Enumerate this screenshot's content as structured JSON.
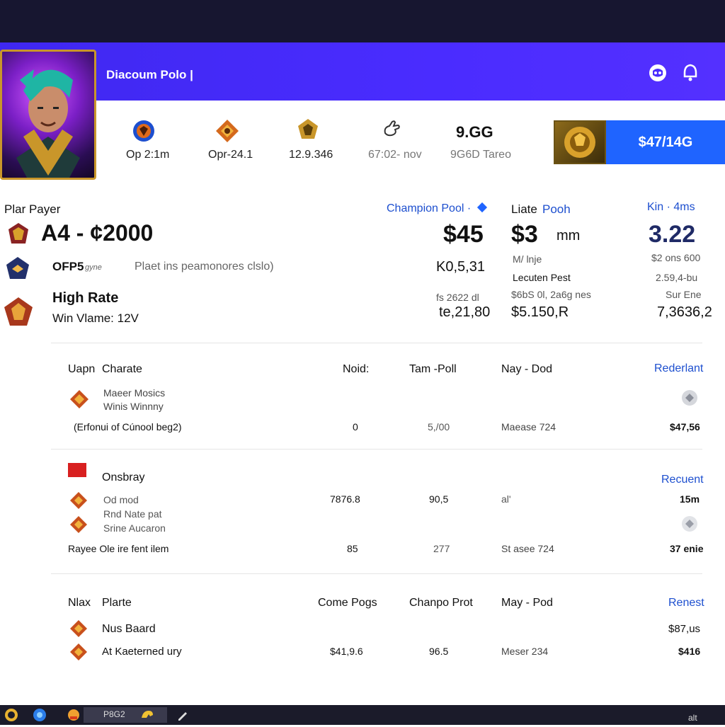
{
  "header": {
    "title": "Diacoum Polo |",
    "icons": [
      "discord-icon",
      "notification-bell-icon"
    ]
  },
  "stats": [
    {
      "icon": "emblem-blue-icon",
      "label": "Op 2:1m"
    },
    {
      "icon": "emblem-orange-icon",
      "label": "Opr-24.1"
    },
    {
      "icon": "emblem-gold-icon",
      "label": "12.9.346"
    },
    {
      "icon": "hand-icon",
      "label": "67:02- nov"
    },
    {
      "icon": "",
      "value": "9.GG",
      "label": "9G6D Tareo"
    }
  ],
  "price_button": "$47/14G",
  "player": {
    "section_label": "Plar Payer",
    "headline": "A4  -  ¢2000",
    "row1": {
      "label": "OFP5",
      "tag": "gyne",
      "desc": "Plaet ins peamonores clslo)"
    },
    "row2": {
      "title": "High Rate",
      "subtitle": "Win Vlame: 12V"
    }
  },
  "columns": {
    "champion_pool": {
      "label": "Champion Pool ·",
      "main": "$45",
      "line1": "K0,5,31",
      "line2": "fs 2622 dl",
      "line3": "te,21,80"
    },
    "liate": {
      "label_a": "Liate",
      "label_b": "Pooh",
      "main": "$3",
      "unit": "mm",
      "line1": "M/ lnje",
      "line2": "Lecuten Pest",
      "line3": "$6bS 0l, 2a6g nes",
      "line4": "$5.150,R"
    },
    "kin": {
      "label": "Kin · 4ms",
      "main": "3.22",
      "line1": "$2 ons 600",
      "line2": "2.59,4-bu",
      "line3": "Sur Ene",
      "line4": "7,3636,2"
    }
  },
  "sections": [
    {
      "headers": [
        "Uapn",
        "Charate",
        "Noid:",
        "Tam -Poll",
        "Nay - Dod",
        "Rederlant"
      ],
      "rows": [
        {
          "name_a": "Maeer Mosics",
          "name_b": "Winis Winnny"
        },
        {
          "name": "(Erfonui of Cúnool beg2)",
          "c1": "0",
          "c2": "5,/00",
          "c3": "Maease 724",
          "c4": "$47,56"
        }
      ]
    },
    {
      "headers": [
        "Onsbray",
        "Recuent"
      ],
      "rows": [
        {
          "name": "Od mod",
          "c1": "7876.8",
          "c2": "90,5",
          "c3": "al'",
          "c4": "15m"
        },
        {
          "name_a": "Rnd Nate pat",
          "name_b": "Srine Aucaron"
        },
        {
          "name": "Rayee Ole ire fent ilem",
          "c1": "85",
          "c2": "277",
          "c3": "St asee 724",
          "c4": "37 enie"
        }
      ]
    },
    {
      "headers": [
        "Nlax",
        "Plarte",
        "Come Pogs",
        "Chanpo Prot",
        "May - Pod",
        "Renest"
      ],
      "rows": [
        {
          "name": "Nus Baard",
          "c4": "$87,us"
        },
        {
          "name": "At Kaeterned ury",
          "c1": "$41,9.6",
          "c2": "96.5",
          "c3": "Meser 234",
          "c4": "$416"
        }
      ]
    }
  ],
  "taskbar": {
    "items": [
      "P8G2"
    ],
    "tray": "alt"
  }
}
